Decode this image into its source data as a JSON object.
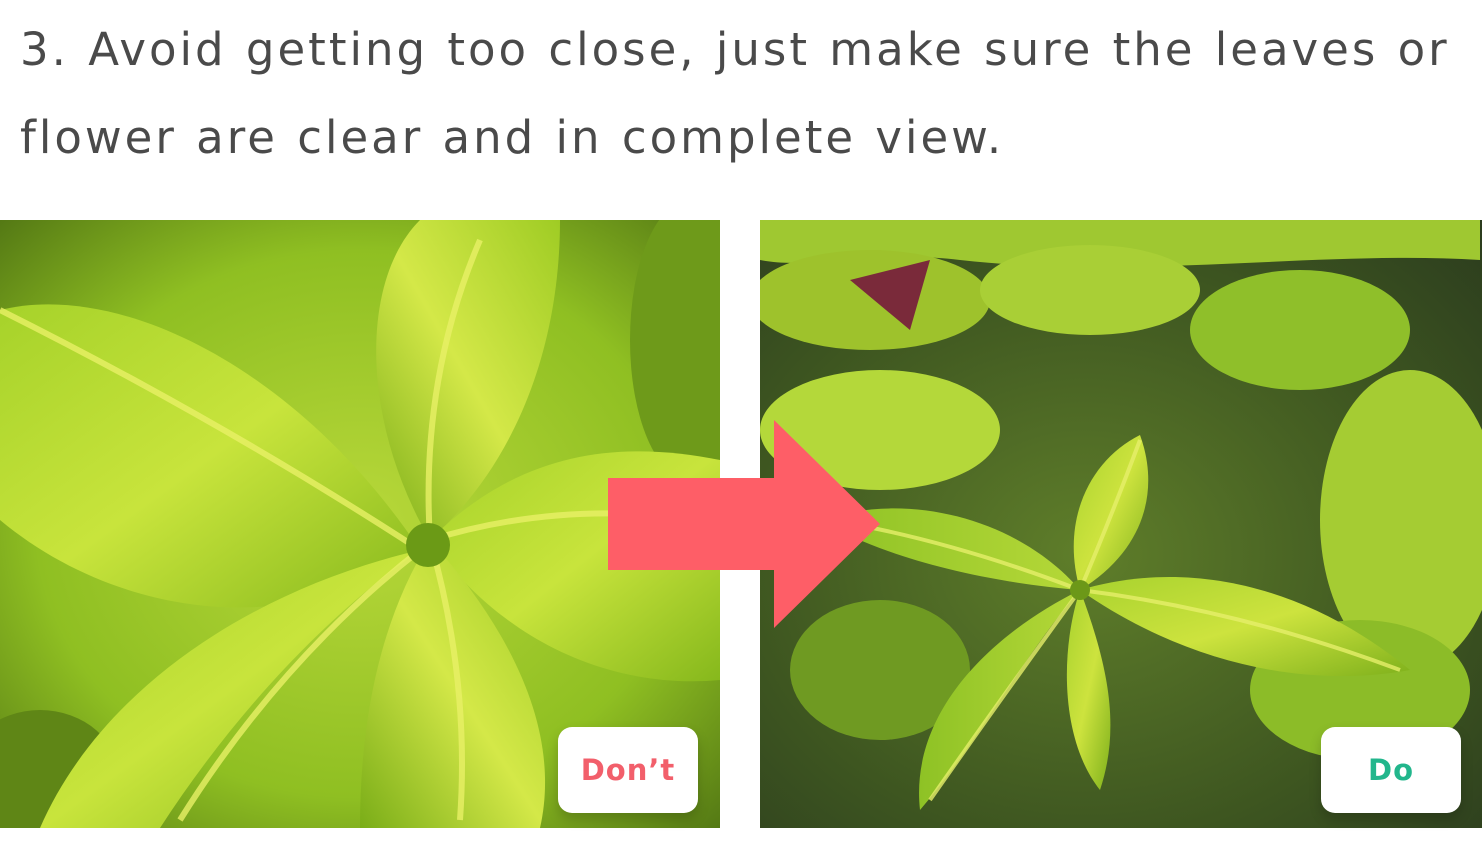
{
  "instruction": {
    "text": "3. Avoid getting too close, just make sure the leaves or flower are clear and in complete view."
  },
  "examples": {
    "dont": {
      "label": "Don’t",
      "label_color": "#f25f6b"
    },
    "do": {
      "label": "Do",
      "label_color": "#22b68c"
    }
  },
  "arrow": {
    "icon": "arrow-right-icon",
    "color": "#fe5e67"
  }
}
